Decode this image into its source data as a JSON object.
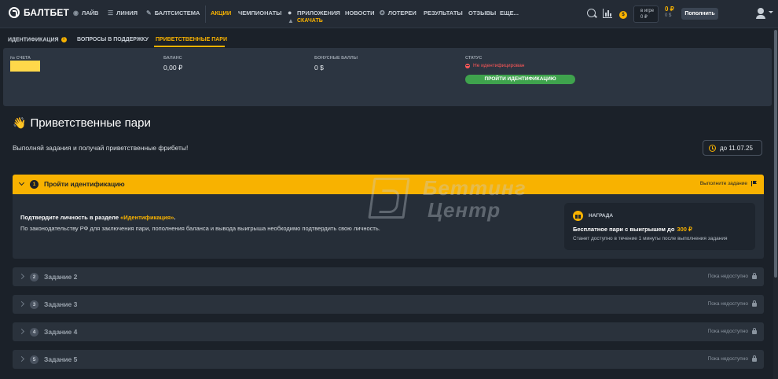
{
  "brand": {
    "name": "БАЛТБЕТ"
  },
  "nav": {
    "items": [
      {
        "label": "ЛАЙВ",
        "icon": "live-icon"
      },
      {
        "label": "ЛИНИЯ",
        "icon": "list-icon"
      },
      {
        "label": "БАЛТСИСТЕМА",
        "icon": "pen-icon"
      },
      {
        "label": "АКЦИИ",
        "active": true
      },
      {
        "label": "ЧЕМПИОНАТЫ"
      },
      {
        "label": "ПРИЛОЖЕНИЯ",
        "sub": "СКАЧАТЬ"
      },
      {
        "label": "НОВОСТИ"
      },
      {
        "label": "ЛОТЕРЕИ",
        "icon": "lottery-icon"
      },
      {
        "label": "РЕЗУЛЬТАТЫ"
      },
      {
        "label": "ОТЗЫВЫ"
      },
      {
        "label": "ЕЩЕ..."
      }
    ],
    "ingame": {
      "label": "в игре",
      "value": "0 ₽"
    },
    "balance": {
      "main": "0 ₽",
      "sub": "0 $"
    },
    "topup_label": "Пополнить",
    "coin_badge": "$"
  },
  "subtabs": [
    {
      "label": "ИДЕНТИФИКАЦИЯ",
      "badge": "!"
    },
    {
      "label": "ВОПРОСЫ В ПОДДЕРЖКУ"
    },
    {
      "label": "ПРИВЕТСТВЕННЫЕ ПАРИ",
      "active": true
    }
  ],
  "account": {
    "number_label": "№ СЧЕТА",
    "balance_label": "БАЛАНС",
    "balance_value": "0,00 ₽",
    "bonus_label": "БОНУСНЫЕ БАЛЛЫ",
    "bonus_value": "0 $",
    "status_label": "СТАТУС",
    "status_value": "Не идентифицирован",
    "identify_button": "ПРОЙТИ ИДЕНТИФИКАЦИЮ"
  },
  "main": {
    "title": "Приветственные пари",
    "title_emoji": "👋",
    "intro": "Выполняй задания и получай приветственные фрибеты!",
    "deadline": "до 11.07.25"
  },
  "task1": {
    "number": "1",
    "title": "Пройти идентификацию",
    "hint": "Выполните задание",
    "body_prefix": "Подтвердите личность в разделе ",
    "body_link": "«Идентификация»",
    "body_suffix": ".",
    "body2": "По законодательству РФ для заключения пари, пополнения баланса и вывода выигрыша необходимо подтвердить свою личность.",
    "reward_label": "НАГРАДА",
    "reward_main": "Бесплатное пари с выигрышем до",
    "reward_amount": "300 ₽",
    "reward_note": "Станет доступно в течение 1 минуты после выполнения задания"
  },
  "tasks": [
    {
      "number": "2",
      "title": "Задание 2",
      "status": "Пока недоступно"
    },
    {
      "number": "3",
      "title": "Задание 3",
      "status": "Пока недоступно"
    },
    {
      "number": "4",
      "title": "Задание 4",
      "status": "Пока недоступно"
    },
    {
      "number": "5",
      "title": "Задание 5",
      "status": "Пока недоступно"
    }
  ],
  "watermark": {
    "line1": "Беттинг",
    "line2": "Центр"
  },
  "colors": {
    "accent": "#f8b200",
    "bg": "#1b2129",
    "panel": "#2c3541",
    "success": "#3fa34d",
    "danger": "#ff5757"
  }
}
